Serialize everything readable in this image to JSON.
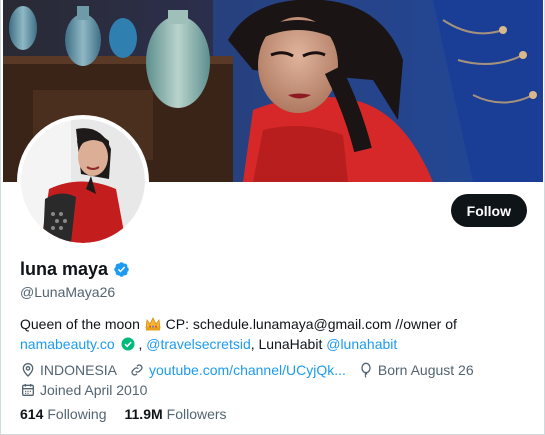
{
  "profile": {
    "display_name": "luna maya",
    "handle": "@LunaMaya26",
    "follow_label": "Follow",
    "bio": {
      "line1_text": "Queen of the moon",
      "line1_after": "CP: schedule.lunamaya@gmail.com //owner of",
      "link1": "namabeauty.co",
      "sep1": ",",
      "link2": "@travelsecretsid",
      "text2": ", LunaHabit",
      "link3": "@lunahabit"
    },
    "location": "INDONESIA",
    "website": "youtube.com/channel/UCyjQk...",
    "birthday": "Born August 26",
    "joined": "Joined April 2010",
    "following_count": "614",
    "following_label": "Following",
    "followers_count": "11.9M",
    "followers_label": "Followers"
  },
  "colors": {
    "accent": "#1d9bf0",
    "follow_bg": "#0f1419",
    "secondary_text": "#536471"
  },
  "icons": [
    "verified-badge-icon",
    "crown-emoji-icon",
    "location-pin-icon",
    "link-icon",
    "balloon-icon",
    "calendar-icon"
  ]
}
